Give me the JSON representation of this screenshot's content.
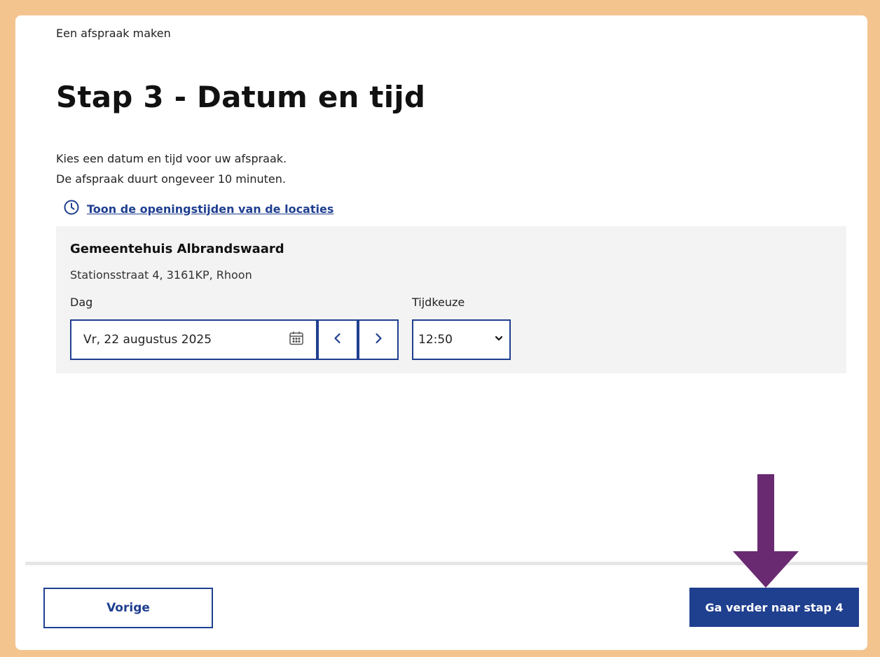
{
  "breadcrumb": "Een afspraak maken",
  "title": "Stap 3 - Datum en tijd",
  "intro": {
    "line1": "Kies een datum en tijd voor uw afspraak.",
    "line2": "De afspraak duurt ongeveer 10 minuten."
  },
  "hours_link": {
    "label": "Toon de openingstijden van de locaties",
    "icon": "clock-icon"
  },
  "location": {
    "name": "Gemeentehuis Albrandswaard",
    "address": "Stationsstraat 4, 3161KP, Rhoon"
  },
  "day_field": {
    "label": "Dag",
    "value": "Vr, 22 augustus 2025",
    "icon": "calendar-icon"
  },
  "time_field": {
    "label": "Tijdkeuze",
    "value": "12:50"
  },
  "footer": {
    "prev_label": "Vorige",
    "next_label": "Ga verder naar stap 4"
  },
  "colors": {
    "primary": "#1f3f8f",
    "frame": "#f4c48f",
    "panel": "#f3f3f3",
    "annotation_arrow": "#6a2a72"
  }
}
